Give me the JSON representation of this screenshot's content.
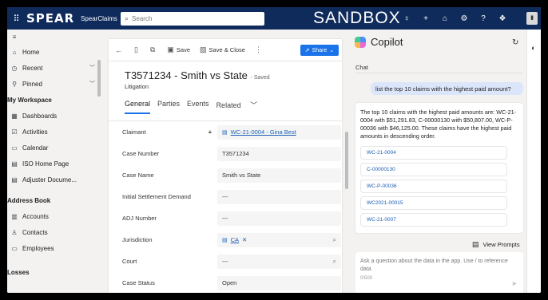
{
  "topbar": {
    "logo": "SPEAR",
    "app_name": "SpearClaims",
    "search_placeholder": "Search",
    "environment": "SANDBOX"
  },
  "sidebar": {
    "items": [
      {
        "label": "Home",
        "icon": "home-icon"
      },
      {
        "label": "Recent",
        "icon": "clock-icon",
        "expandable": true
      },
      {
        "label": "Pinned",
        "icon": "pin-icon",
        "expandable": true
      }
    ],
    "sections": [
      {
        "title": "My Workspace",
        "items": [
          "Dashboards",
          "Activities",
          "Calendar",
          "ISO Home Page",
          "Adjuster Docume..."
        ]
      },
      {
        "title": "Address Book",
        "items": [
          "Accounts",
          "Contacts",
          "Employees"
        ]
      },
      {
        "title": "Losses",
        "items": []
      }
    ]
  },
  "commandbar": {
    "save": "Save",
    "save_close": "Save & Close",
    "share": "Share"
  },
  "record": {
    "title": "T3571234 - Smith vs State",
    "status": "- Saved",
    "type": "Litigation",
    "tabs": [
      "General",
      "Parties",
      "Events",
      "Related"
    ]
  },
  "form": {
    "fields": [
      {
        "label": "Claimant",
        "value": "WC-21-0004 - Gina Best",
        "kind": "lookup"
      },
      {
        "label": "Case Number",
        "value": "T3571234",
        "kind": "text"
      },
      {
        "label": "Case Name",
        "value": "Smith vs State",
        "kind": "text"
      },
      {
        "label": "Initial Settlement Demand",
        "value": "---",
        "kind": "empty"
      },
      {
        "label": "ADJ Number",
        "value": "---",
        "kind": "empty"
      },
      {
        "label": "Jurisdiction",
        "value": "CA",
        "kind": "chip"
      },
      {
        "label": "Court",
        "value": "---",
        "kind": "search"
      },
      {
        "label": "Case Status",
        "value": "Open",
        "kind": "text"
      }
    ]
  },
  "copilot": {
    "title": "Copilot",
    "tab": "Chat",
    "user_message": "list the top 10 claims with the highest paid amount?",
    "response": "The top 10 claims with the highest paid amounts are: WC-21-0004 with $51,291.83, C-00000130 with $50,807.00, WC-P-00036 with $46,125.00. These claims have the highest paid amounts in descending order.",
    "references": [
      "WC-21-0004",
      "C-00000130",
      "WC-P-00036",
      "WC2021-00015",
      "WC-21-0007"
    ],
    "view_prompts": "View Prompts",
    "input_placeholder": "Ask a question about the data in the app. Use / to reference data",
    "char_count": "0/500"
  }
}
